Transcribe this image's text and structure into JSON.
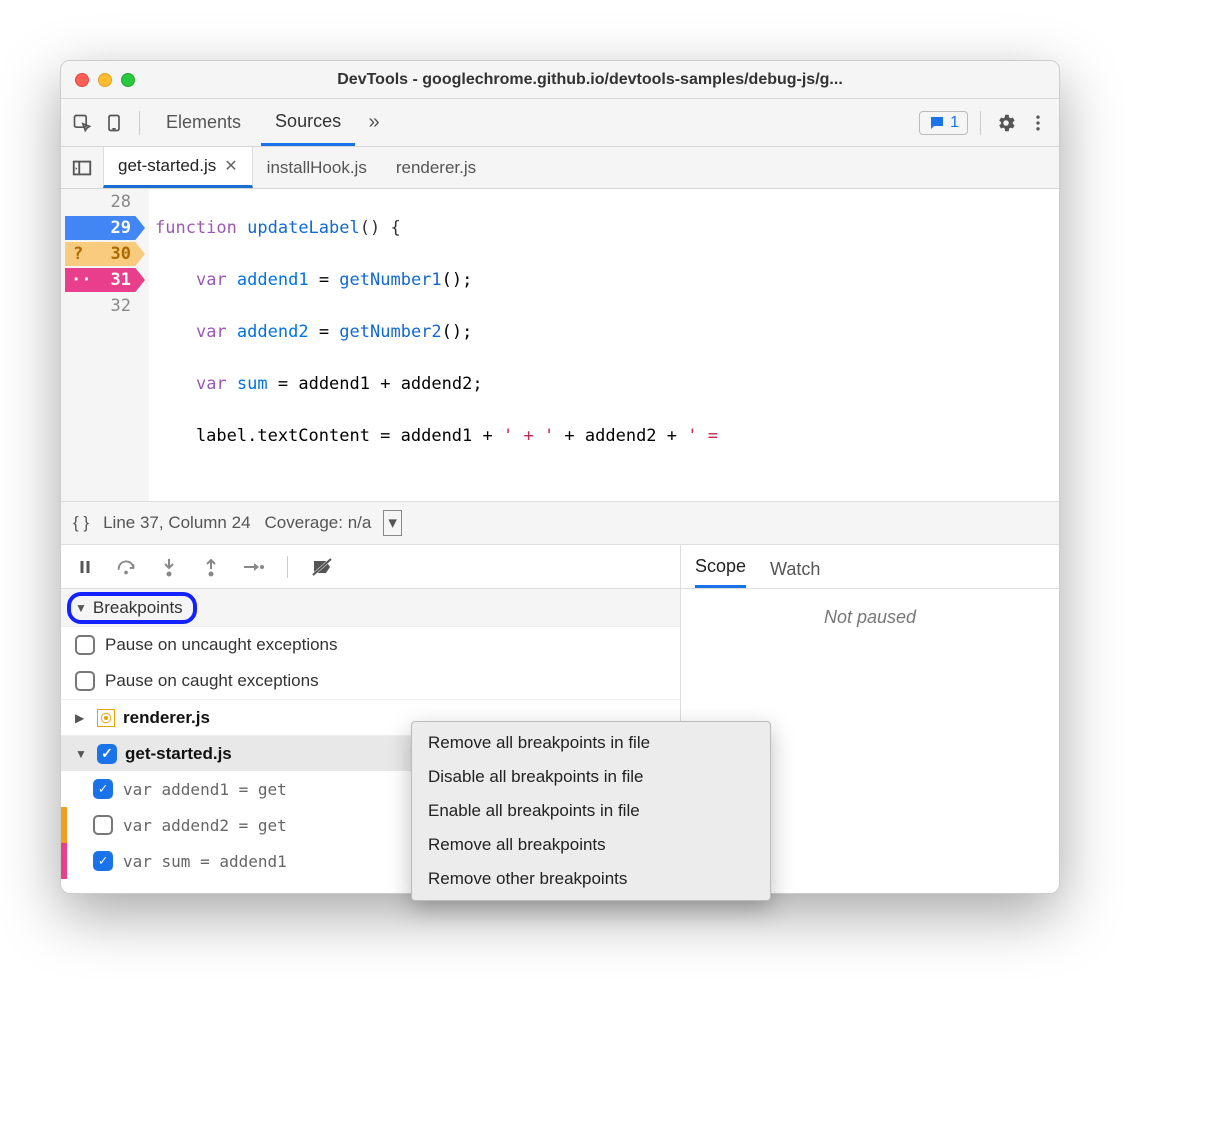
{
  "window": {
    "title": "DevTools - googlechrome.github.io/devtools-samples/debug-js/g..."
  },
  "topbar": {
    "tabs": {
      "elements": "Elements",
      "sources": "Sources"
    },
    "feedback_count": "1"
  },
  "filetabs": {
    "t0": "get-started.js",
    "t1": "installHook.js",
    "t2": "renderer.js"
  },
  "code": {
    "ln28": "28",
    "ln29": "29",
    "ln30": "30",
    "ln31": "31",
    "ln32": "32",
    "bp30_glyph": "?",
    "bp31_glyph": "··",
    "l28_kw": "function",
    "l28_name": "updateLabel",
    "l28_tail": "() {",
    "l29_kw": "var",
    "l29_var": "addend1",
    "l29_eq": " = ",
    "l29_call": "getNumber1",
    "l29_tail": "();",
    "l30_kw": "var",
    "l30_var": "addend2",
    "l30_eq": " = ",
    "l30_call": "getNumber2",
    "l30_tail": "();",
    "l31_kw": "var",
    "l31_var": "sum",
    "l31_tail": " = addend1 + addend2;",
    "l32_a": "    label.textContent = addend1 + ",
    "l32_s1": "' + '",
    "l32_b": " + addend2 + ",
    "l32_s2": "' = "
  },
  "statusbar": {
    "braces": "{ }",
    "position": "Line 37, Column 24",
    "coverage": "Coverage: n/a"
  },
  "breakpoints": {
    "header": "Breakpoints",
    "pause_uncaught": "Pause on uncaught exceptions",
    "pause_caught": "Pause on caught exceptions",
    "file0": "renderer.js",
    "file1": "get-started.js",
    "line1": "var addend1 = get",
    "line2": "var addend2 = get",
    "line3": "var sum = addend1"
  },
  "right": {
    "tab_scope": "Scope",
    "tab_watch": "Watch",
    "not_paused": "Not paused"
  },
  "ctxmenu": {
    "i0": "Remove all breakpoints in file",
    "i1": "Disable all breakpoints in file",
    "i2": "Enable all breakpoints in file",
    "i3": "Remove all breakpoints",
    "i4": "Remove other breakpoints"
  }
}
